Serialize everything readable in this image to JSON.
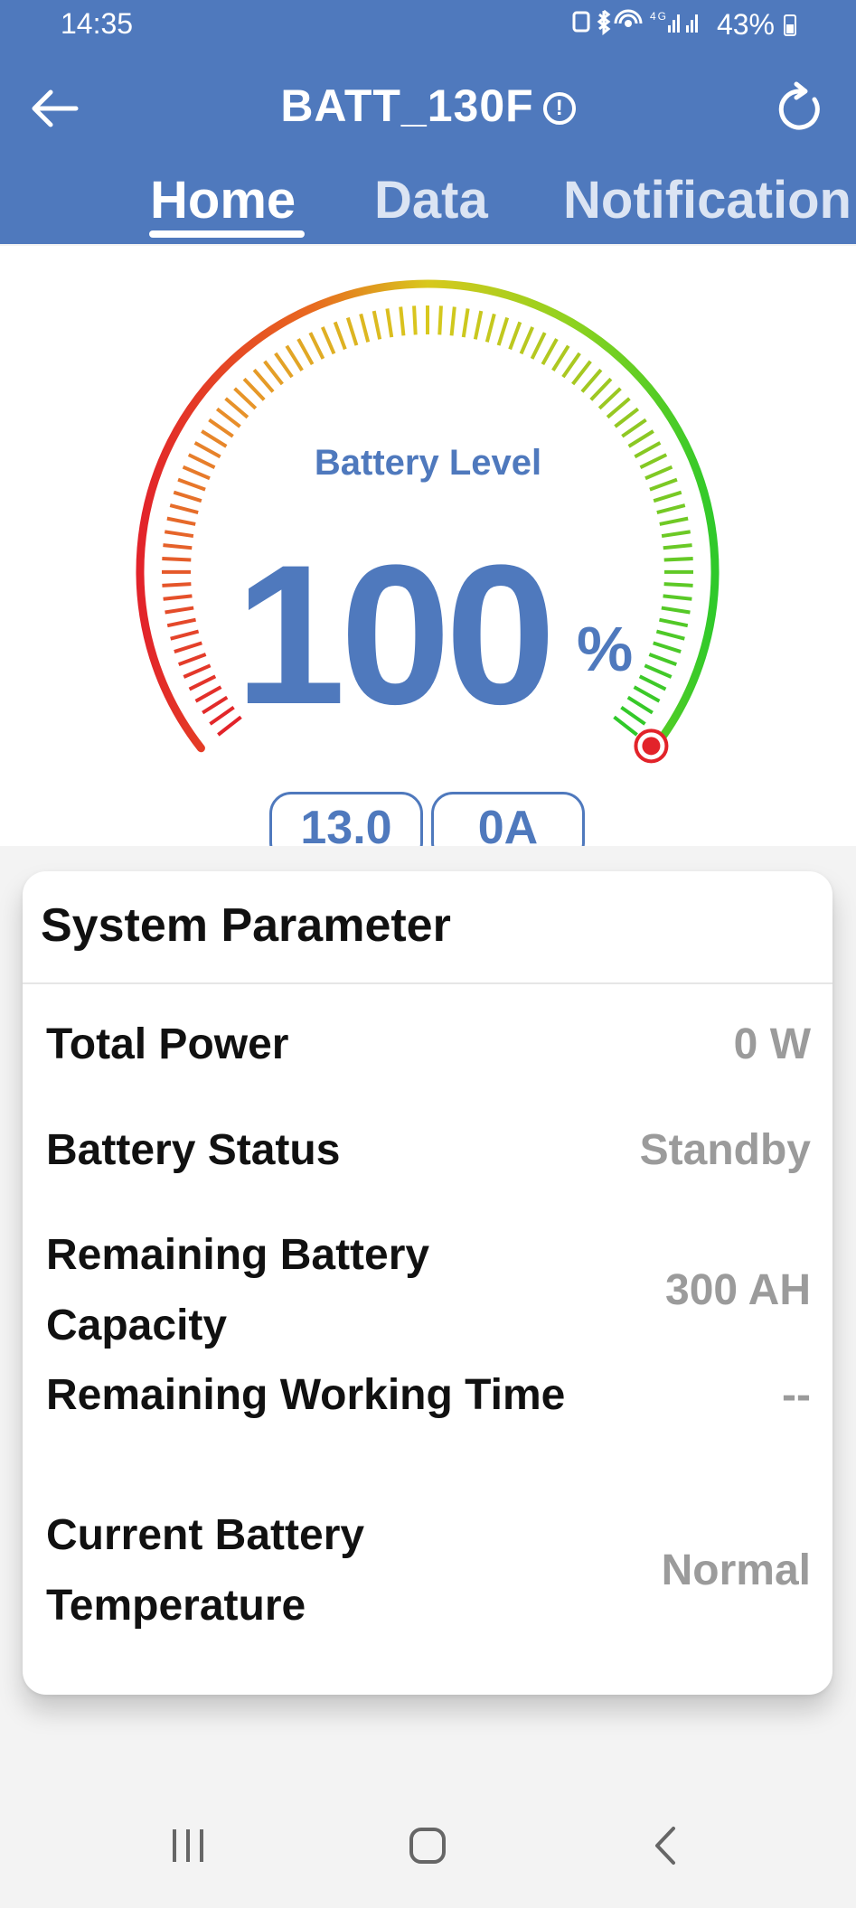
{
  "status_bar": {
    "time": "14:35",
    "icons": [
      "recycle-icon",
      "bluetooth-icon",
      "hotspot-icon",
      "4g-icon",
      "signal-icon",
      "signal-icon"
    ],
    "network_label": "4G",
    "battery_percent": "43%"
  },
  "header": {
    "title": "BATT_130F",
    "info_glyph": "!",
    "back_glyph": "←",
    "tabs": [
      {
        "label": "Home",
        "active": true
      },
      {
        "label": "Data",
        "active": false
      },
      {
        "label": "Notification",
        "active": false
      }
    ]
  },
  "gauge": {
    "title": "Battery Level",
    "value": "100",
    "unit": "%",
    "level_fraction": 1.0,
    "pills": [
      {
        "label": "13.0"
      },
      {
        "label": "0A"
      }
    ]
  },
  "system_parameter": {
    "title": "System Parameter",
    "rows": [
      {
        "label": "Total Power",
        "value": "0 W"
      },
      {
        "label": "Battery Status",
        "value": "Standby"
      },
      {
        "label": "Remaining Battery Capacity",
        "value": "300 AH"
      },
      {
        "label": "Remaining Working Time",
        "value": "--"
      },
      {
        "label": "Current Battery Temperature",
        "value": "Normal"
      }
    ]
  },
  "colors": {
    "primary": "#4f79bd",
    "value_gray": "#9b9b9b",
    "gauge_start": "#e2232a",
    "gauge_mid": "#d8c81d",
    "gauge_end": "#2fc92a"
  }
}
